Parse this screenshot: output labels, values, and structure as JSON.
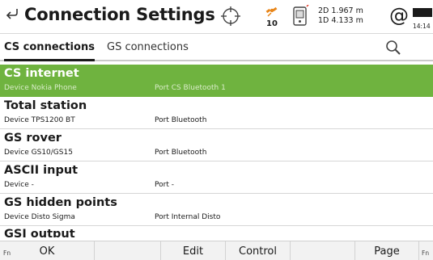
{
  "header": {
    "title": "Connection Settings",
    "satellite_count": "10",
    "quality_2d": "2D 1.967 m",
    "quality_1d": "1D 4.133 m",
    "at_symbol": "@",
    "time": "14:14",
    "icons": [
      "back-icon",
      "crosshair-icon",
      "satellite-icon",
      "device-icon",
      "at-icon",
      "battery-icon"
    ]
  },
  "tabs": [
    {
      "label": "CS connections",
      "active": true
    },
    {
      "label": "GS connections",
      "active": false
    }
  ],
  "search_icon": "search-icon",
  "connections": [
    {
      "title": "CS internet",
      "device": "Device  Nokia Phone",
      "port": "Port  CS Bluetooth 1",
      "selected": true
    },
    {
      "title": "Total station",
      "device": "Device  TPS1200 BT",
      "port": "Port  Bluetooth",
      "selected": false
    },
    {
      "title": "GS rover",
      "device": "Device  GS10/GS15",
      "port": "Port  Bluetooth",
      "selected": false
    },
    {
      "title": "ASCII input",
      "device": "Device  -",
      "port": "Port  -",
      "selected": false
    },
    {
      "title": "GS hidden points",
      "device": "Device  Disto Sigma",
      "port": "Port  Internal Disto",
      "selected": false
    },
    {
      "title": "GSI output",
      "device": "",
      "port": "",
      "selected": false
    }
  ],
  "function_keys": [
    {
      "fn": "Fn",
      "label": "OK"
    },
    {
      "fn": "",
      "label": ""
    },
    {
      "fn": "",
      "label": "Edit"
    },
    {
      "fn": "",
      "label": "Control"
    },
    {
      "fn": "",
      "label": ""
    },
    {
      "fn": "",
      "label": "Page"
    },
    {
      "fn": "Fn",
      "label": ""
    }
  ],
  "colors": {
    "selected_row": "#6fb33f",
    "satellite_accent": "#e8861a"
  }
}
